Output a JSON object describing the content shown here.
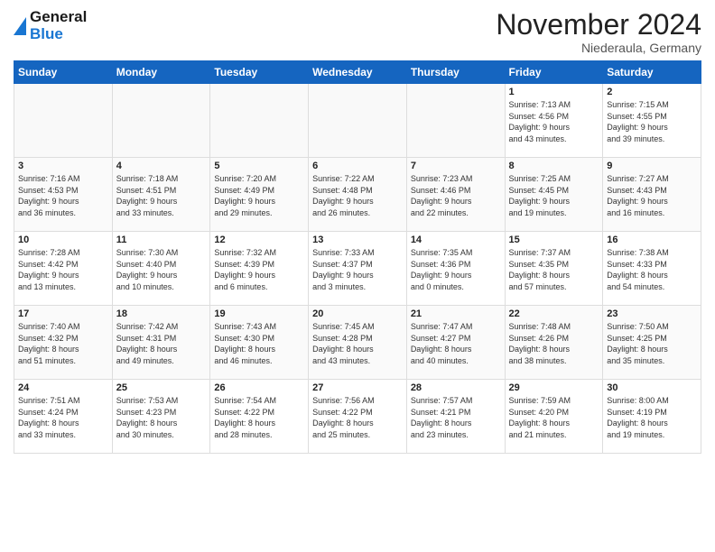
{
  "header": {
    "logo_line1": "General",
    "logo_line2": "Blue",
    "month_title": "November 2024",
    "location": "Niederaula, Germany"
  },
  "weekdays": [
    "Sunday",
    "Monday",
    "Tuesday",
    "Wednesday",
    "Thursday",
    "Friday",
    "Saturday"
  ],
  "weeks": [
    [
      {
        "day": "",
        "info": ""
      },
      {
        "day": "",
        "info": ""
      },
      {
        "day": "",
        "info": ""
      },
      {
        "day": "",
        "info": ""
      },
      {
        "day": "",
        "info": ""
      },
      {
        "day": "1",
        "info": "Sunrise: 7:13 AM\nSunset: 4:56 PM\nDaylight: 9 hours\nand 43 minutes."
      },
      {
        "day": "2",
        "info": "Sunrise: 7:15 AM\nSunset: 4:55 PM\nDaylight: 9 hours\nand 39 minutes."
      }
    ],
    [
      {
        "day": "3",
        "info": "Sunrise: 7:16 AM\nSunset: 4:53 PM\nDaylight: 9 hours\nand 36 minutes."
      },
      {
        "day": "4",
        "info": "Sunrise: 7:18 AM\nSunset: 4:51 PM\nDaylight: 9 hours\nand 33 minutes."
      },
      {
        "day": "5",
        "info": "Sunrise: 7:20 AM\nSunset: 4:49 PM\nDaylight: 9 hours\nand 29 minutes."
      },
      {
        "day": "6",
        "info": "Sunrise: 7:22 AM\nSunset: 4:48 PM\nDaylight: 9 hours\nand 26 minutes."
      },
      {
        "day": "7",
        "info": "Sunrise: 7:23 AM\nSunset: 4:46 PM\nDaylight: 9 hours\nand 22 minutes."
      },
      {
        "day": "8",
        "info": "Sunrise: 7:25 AM\nSunset: 4:45 PM\nDaylight: 9 hours\nand 19 minutes."
      },
      {
        "day": "9",
        "info": "Sunrise: 7:27 AM\nSunset: 4:43 PM\nDaylight: 9 hours\nand 16 minutes."
      }
    ],
    [
      {
        "day": "10",
        "info": "Sunrise: 7:28 AM\nSunset: 4:42 PM\nDaylight: 9 hours\nand 13 minutes."
      },
      {
        "day": "11",
        "info": "Sunrise: 7:30 AM\nSunset: 4:40 PM\nDaylight: 9 hours\nand 10 minutes."
      },
      {
        "day": "12",
        "info": "Sunrise: 7:32 AM\nSunset: 4:39 PM\nDaylight: 9 hours\nand 6 minutes."
      },
      {
        "day": "13",
        "info": "Sunrise: 7:33 AM\nSunset: 4:37 PM\nDaylight: 9 hours\nand 3 minutes."
      },
      {
        "day": "14",
        "info": "Sunrise: 7:35 AM\nSunset: 4:36 PM\nDaylight: 9 hours\nand 0 minutes."
      },
      {
        "day": "15",
        "info": "Sunrise: 7:37 AM\nSunset: 4:35 PM\nDaylight: 8 hours\nand 57 minutes."
      },
      {
        "day": "16",
        "info": "Sunrise: 7:38 AM\nSunset: 4:33 PM\nDaylight: 8 hours\nand 54 minutes."
      }
    ],
    [
      {
        "day": "17",
        "info": "Sunrise: 7:40 AM\nSunset: 4:32 PM\nDaylight: 8 hours\nand 51 minutes."
      },
      {
        "day": "18",
        "info": "Sunrise: 7:42 AM\nSunset: 4:31 PM\nDaylight: 8 hours\nand 49 minutes."
      },
      {
        "day": "19",
        "info": "Sunrise: 7:43 AM\nSunset: 4:30 PM\nDaylight: 8 hours\nand 46 minutes."
      },
      {
        "day": "20",
        "info": "Sunrise: 7:45 AM\nSunset: 4:28 PM\nDaylight: 8 hours\nand 43 minutes."
      },
      {
        "day": "21",
        "info": "Sunrise: 7:47 AM\nSunset: 4:27 PM\nDaylight: 8 hours\nand 40 minutes."
      },
      {
        "day": "22",
        "info": "Sunrise: 7:48 AM\nSunset: 4:26 PM\nDaylight: 8 hours\nand 38 minutes."
      },
      {
        "day": "23",
        "info": "Sunrise: 7:50 AM\nSunset: 4:25 PM\nDaylight: 8 hours\nand 35 minutes."
      }
    ],
    [
      {
        "day": "24",
        "info": "Sunrise: 7:51 AM\nSunset: 4:24 PM\nDaylight: 8 hours\nand 33 minutes."
      },
      {
        "day": "25",
        "info": "Sunrise: 7:53 AM\nSunset: 4:23 PM\nDaylight: 8 hours\nand 30 minutes."
      },
      {
        "day": "26",
        "info": "Sunrise: 7:54 AM\nSunset: 4:22 PM\nDaylight: 8 hours\nand 28 minutes."
      },
      {
        "day": "27",
        "info": "Sunrise: 7:56 AM\nSunset: 4:22 PM\nDaylight: 8 hours\nand 25 minutes."
      },
      {
        "day": "28",
        "info": "Sunrise: 7:57 AM\nSunset: 4:21 PM\nDaylight: 8 hours\nand 23 minutes."
      },
      {
        "day": "29",
        "info": "Sunrise: 7:59 AM\nSunset: 4:20 PM\nDaylight: 8 hours\nand 21 minutes."
      },
      {
        "day": "30",
        "info": "Sunrise: 8:00 AM\nSunset: 4:19 PM\nDaylight: 8 hours\nand 19 minutes."
      }
    ]
  ]
}
